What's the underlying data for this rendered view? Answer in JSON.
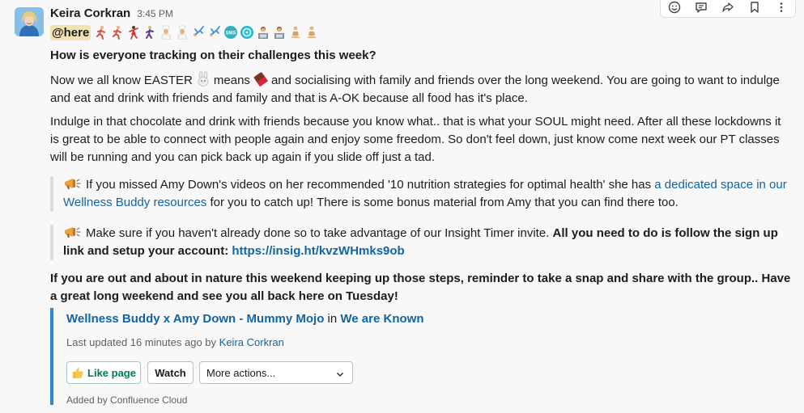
{
  "message": {
    "author": "Keira Corkran",
    "time": "3:45 PM",
    "mention": "@here",
    "emoji_names": [
      "person-running",
      "person-running",
      "woman-dancing",
      "person-running",
      "cook",
      "cook",
      "person-cartwheeling",
      "person-cartwheeling",
      "sms-icon",
      "spinner-icon",
      "technologist",
      "technologist",
      "person-in-lotus",
      "person-in-lotus"
    ],
    "heading": "How is everyone tracking on their challenges this week?",
    "para1_pre": "Now we all know EASTER",
    "para1_means": "means",
    "para1_post": "and socialising with family and friends over the long weekend. You are going to want to indulge and eat and drink with friends and family and that is A-OK because all food has it's place.",
    "para2": "Indulge in that chocolate and drink with friends because you know what.. that is what your SOUL might need. After all these lockdowns it is great to be able to connect with people again and enjoy some freedom. So don't feel down, just know come next week our PT classes will be running and you can pick back up again if you slide off just a tad.",
    "quote1_pre": "If you missed Amy Down's videos on her recommended '10 nutrition strategies for optimal health' she has",
    "quote1_link": "a dedicated space in our Wellness Buddy resources",
    "quote1_post": "for you to catch up! There is some bonus material from Amy that you can find there too.",
    "quote2_pre": "Make sure if you haven't already done so to take advantage of our Insight Timer invite.",
    "quote2_bold": "All you need to do is follow the sign up link and setup your account:",
    "quote2_link": "https://insig.ht/kvzWHmks9ob",
    "closing": "If you are out and about in nature this weekend keeping up those steps, reminder to take a snap and share with the group.. Have a great long weekend and see you all back here on Tuesday!"
  },
  "attachment": {
    "page_title": "Wellness Buddy x Amy Down - Mummy Mojo",
    "in_word": "in",
    "space_name": "We are Known",
    "meta_pre": "Last updated 16 minutes ago by",
    "meta_author": "Keira Corkran",
    "like_label": "Like page",
    "watch_label": "Watch",
    "more_actions": "More actions...",
    "footer": "Added by Confluence Cloud"
  },
  "toolbar": {
    "icons": [
      "emoji-reaction-icon",
      "reply-thread-icon",
      "share-icon",
      "bookmark-icon",
      "more-icon"
    ]
  },
  "colors": {
    "link": "#1264a3",
    "mention_bg": "#f2e3b0",
    "attachment_bar": "#2d88d9",
    "quote_bar": "#dddddd",
    "like_green": "#007a5a"
  }
}
